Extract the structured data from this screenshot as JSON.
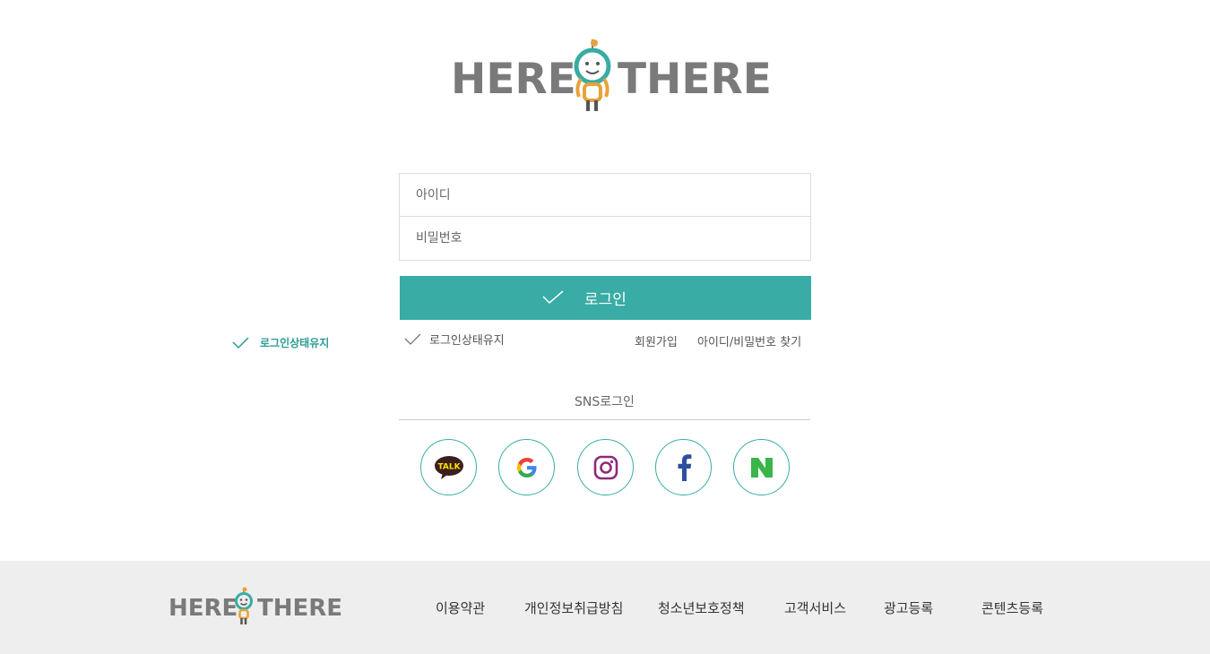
{
  "brand": {
    "left": "HERE",
    "right": "THERE"
  },
  "login": {
    "id_placeholder": "아이디",
    "password_placeholder": "비밀번호",
    "button_label": "로그인",
    "keep_login_label": "로그인상태유지",
    "floating_keep_login_label": "로그인상태유지",
    "signup_label": "회원가입",
    "find_account_label": "아이디/비밀번호 찾기"
  },
  "sns": {
    "title": "SNS로그인",
    "kakao_text": "TALK",
    "providers": [
      "kakao",
      "google",
      "instagram",
      "facebook",
      "naver"
    ]
  },
  "footer": {
    "links": [
      "이용약관",
      "개인정보취급방침",
      "청소년보호정책",
      "고객서비스",
      "광고등록",
      "콘텐츠등록"
    ]
  },
  "colors": {
    "accent": "#38aca5",
    "logo_gray": "#7a7a7a",
    "mascot_orange": "#e8a23a",
    "footer_bg": "#eeeeee"
  }
}
